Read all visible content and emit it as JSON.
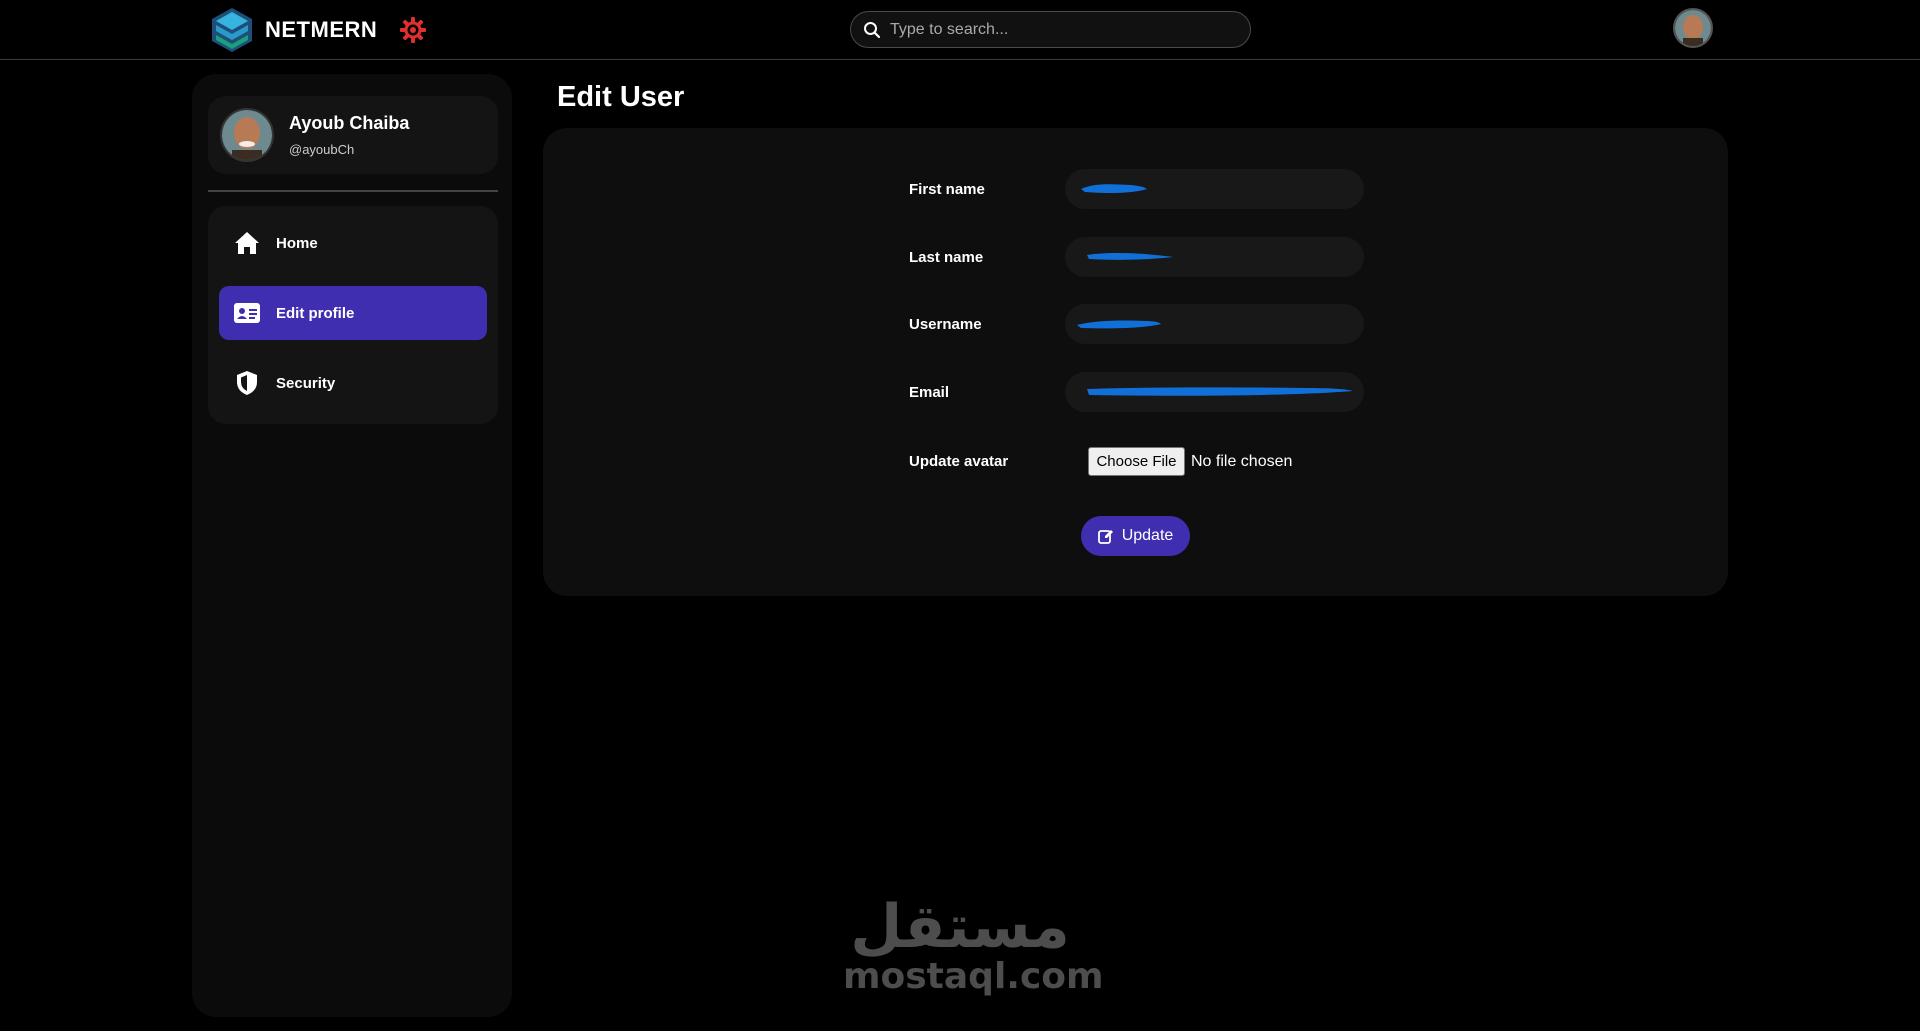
{
  "header": {
    "brand_name": "NETMERN",
    "search_placeholder": "Type to search...",
    "brand_colors": {
      "logo_top": "#2ea3d8",
      "logo_bottom": "#1a9e6e",
      "gear": "#e0302e"
    }
  },
  "sidebar": {
    "profile": {
      "name": "Ayoub Chaiba",
      "handle": "@ayoubCh"
    },
    "items": [
      {
        "label": "Home",
        "icon": "home-icon",
        "active": false
      },
      {
        "label": "Edit profile",
        "icon": "id-card-icon",
        "active": true
      },
      {
        "label": "Security",
        "icon": "shield-icon",
        "active": false
      }
    ]
  },
  "main": {
    "title": "Edit User",
    "form": {
      "first_name_label": "First name",
      "last_name_label": "Last name",
      "username_label": "Username",
      "email_label": "Email",
      "avatar_label": "Update avatar",
      "choose_file_label": "Choose File",
      "file_status": "No file chosen",
      "update_label": "Update"
    }
  },
  "watermark": {
    "arabic": "مستقل",
    "latin": "mostaql.com"
  },
  "colors": {
    "accent": "#3f2fb0",
    "background": "#000000",
    "card": "#0e0e0e",
    "redaction": "#1170d8"
  }
}
